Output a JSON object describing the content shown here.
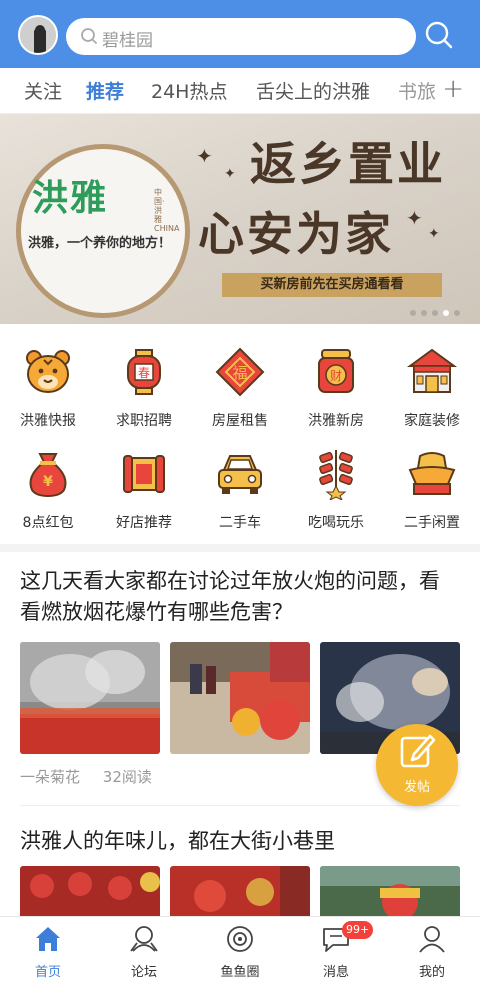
{
  "search": {
    "placeholder": "碧桂园"
  },
  "tabs": [
    {
      "label": "关注"
    },
    {
      "label": "推荐"
    },
    {
      "label": "24H热点"
    },
    {
      "label": "舌尖上的洪雅"
    },
    {
      "label": "书旅"
    }
  ],
  "banner": {
    "logo": "洪雅",
    "logo_side": "中国·洪雅 CHINA",
    "logo_slogan": "洪雅，一个养你的地方！",
    "headline_1": "返乡置业",
    "headline_2": "心安为家",
    "ribbon": "买新房前先在买房通看看",
    "slide_count": 5,
    "active_slide": 4
  },
  "services": [
    {
      "label": "洪雅快报",
      "icon": "tiger-icon"
    },
    {
      "label": "求职招聘",
      "icon": "lantern-icon"
    },
    {
      "label": "房屋租售",
      "icon": "fu-diamond-icon"
    },
    {
      "label": "洪雅新房",
      "icon": "coin-jar-icon"
    },
    {
      "label": "家庭装修",
      "icon": "gate-icon"
    },
    {
      "label": "8点红包",
      "icon": "money-bag-icon"
    },
    {
      "label": "好店推荐",
      "icon": "scroll-icon"
    },
    {
      "label": "二手车",
      "icon": "car-icon"
    },
    {
      "label": "吃喝玩乐",
      "icon": "firecracker-icon"
    },
    {
      "label": "二手闲置",
      "icon": "gold-ingot-icon"
    }
  ],
  "posts": [
    {
      "title": "这几天看大家都在讨论过年放火炮的问题，看看燃放烟花爆竹有哪些危害？",
      "author": "一朵菊花",
      "reads": "32阅读"
    },
    {
      "title": "洪雅人的年味儿，都在大街小巷里"
    }
  ],
  "fab": {
    "label": "发帖"
  },
  "bottom_nav": [
    {
      "label": "首页"
    },
    {
      "label": "论坛"
    },
    {
      "label": "鱼鱼圈"
    },
    {
      "label": "消息",
      "badge": "99+"
    },
    {
      "label": "我的"
    }
  ],
  "colors": {
    "brand": "#4d8fe6",
    "active": "#3d7fd8",
    "fab": "#f5b832",
    "badge": "#f2413a"
  }
}
